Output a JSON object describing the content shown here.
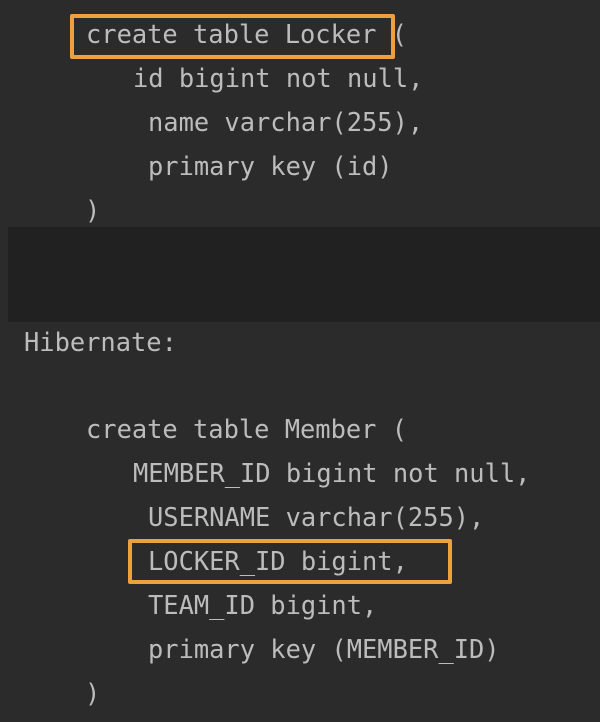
{
  "theme": {
    "background": "#2b2b2b",
    "band_background": "#212121",
    "code_text": "#bcbcbc",
    "highlight_border": "#eda13b"
  },
  "code_block_top": {
    "lines": [
      "create table Locker (",
      "id bigint not null,",
      "name varchar(255),",
      "primary key (id)",
      ")"
    ]
  },
  "separator_label": "Hibernate:",
  "code_block_bottom": {
    "lines": [
      "create table Member (",
      "MEMBER_ID bigint not null,",
      "USERNAME varchar(255),",
      "LOCKER_ID bigint,",
      "TEAM_ID bigint,",
      "primary key (MEMBER_ID)",
      ")"
    ]
  },
  "highlights": [
    {
      "label": "create table Locker"
    },
    {
      "label": "LOCKER_ID bigint,"
    }
  ]
}
